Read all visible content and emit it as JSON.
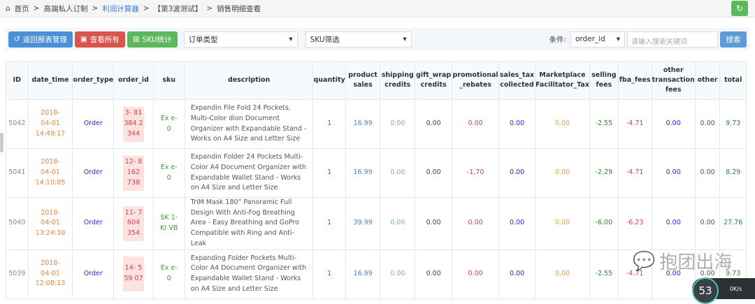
{
  "breadcrumb": [
    "首页",
    "高端私人订制",
    "利润计算器",
    "【第3波测试】",
    "销售明细查看"
  ],
  "toolbar": {
    "back": "返回报表管理",
    "view_all": "查看所有",
    "sku_stats": "SKU统计",
    "order_type": "订单类型",
    "sku_filter": "SKU筛选",
    "condition_label": "条件:",
    "condition_value": "order_id",
    "search_placeholder": "请输入搜索关键词",
    "search": "搜索"
  },
  "headers": [
    "ID",
    "date_time",
    "order_type",
    "order_id",
    "sku",
    "description",
    "quantity",
    "product sales",
    "shipping credits",
    "gift_wrap credits",
    "promotional _rebates",
    "sales_tax collected",
    "Marketplace Facilitator_Tax",
    "selling fees",
    "fba_fees",
    "other transaction fees",
    "other",
    "total"
  ],
  "rows": [
    {
      "id": "5042",
      "date": "2018-04-01 14:48:17",
      "type": "Order",
      "oid": "3- 81 384 2 344",
      "sku": "Ex e- 0",
      "desc": "Expandin File Fold 24 Pockets, Multi-Color dion Document Organizer with Expandable Stand - Works on A4 Size and Letter Size",
      "qty": "1",
      "ps": "16.99",
      "ship": "0.00",
      "gift": "0.00",
      "promo": "0.00",
      "tax": "0.00",
      "mft": "0.00",
      "sell": "-2.55",
      "fba": "-4.71",
      "ot": "0.00",
      "oth": "0.00",
      "tot": "9.73"
    },
    {
      "id": "5041",
      "date": "2018-04-01 14:10:05",
      "type": "Order",
      "oid": "12- 8 162 738",
      "sku": "Ex e- 0",
      "desc": "Expandin Folder 24 Pockets Multi-Color A4 Document Organizer with Expandable Wallet Stand - Works on A4 Size and Letter Size",
      "qty": "1",
      "ps": "16.99",
      "ship": "0.00",
      "gift": "0.00",
      "promo": "-1.70",
      "tax": "0.00",
      "mft": "0.00",
      "sell": "-2.29",
      "fba": "-4.71",
      "ot": "0.00",
      "oth": "0.00",
      "tot": "8.29"
    },
    {
      "id": "5040",
      "date": "2018-04-01 13:24:10",
      "type": "Order",
      "oid": "11- 7 604 354",
      "sku": "SK 1- KI VB",
      "desc": "TriM Mask 180° Panoramic Full Design With Anti-Fog Breathing Area - Easy Breathing and GoPro Compatible with Ring and Anti-Leak",
      "qty": "1",
      "ps": "39.99",
      "ship": "0.00",
      "gift": "0.00",
      "promo": "0.00",
      "tax": "0.00",
      "mft": "0.00",
      "sell": "-6.00",
      "fba": "-6.23",
      "ot": "0.00",
      "oth": "0.00",
      "tot": "27.76"
    },
    {
      "id": "5039",
      "date": "2018-04-01 12:08:13",
      "type": "Order",
      "oid": "14- 5 59 07",
      "sku": "Ex e- 0",
      "desc": "Expanding Folder Pockets Multi-Color A4 Document Organizer with Expandable Wallet Stand - Works on A4 Size and Letter Size",
      "qty": "1",
      "ps": "16.99",
      "ship": "0.00",
      "gift": "0.00",
      "promo": "0.00",
      "tax": "0.00",
      "mft": "0.00",
      "sell": "-2.55",
      "fba": "-4.71",
      "ot": "0.00",
      "oth": "0.00",
      "tot": "9.73"
    }
  ],
  "watermark": "抱团出海",
  "widget": {
    "percent": "53",
    "speed": "0K/s"
  }
}
